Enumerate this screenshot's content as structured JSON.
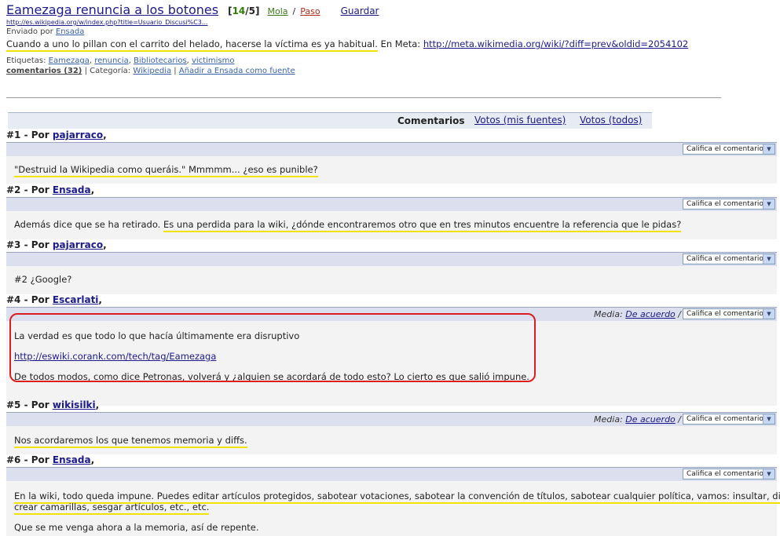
{
  "story": {
    "title": "Eamezaga renuncia a los botones",
    "vote_open": "[",
    "vote_a": "14",
    "vote_sep": "/",
    "vote_b": "5",
    "vote_close": "]",
    "mola": "Mola",
    "slash": "/",
    "paso": "Paso",
    "guardar": "Guardar",
    "url": "http://es.wikipedia.org/w/index.php?title=Usuario_Discusi%C3...",
    "sent_by_label": "Enviado por",
    "sent_by_user": "Ensada",
    "body_text": "Cuando a uno lo pillan con el carrito del helado, hacerse la víctima es ya habitual.",
    "body_meta_label": "En Meta:",
    "body_meta_link": "http://meta.wikimedia.org/wiki/?diff=prev&oldid=2054102",
    "tags_label": "Etiquetas:",
    "tags": [
      "Eamezaga",
      "renuncia",
      "Bibliotecarios",
      "victimismo"
    ],
    "comments_count_label": "comentarios (32)",
    "category_label": "| Categoría:",
    "category": "Wikipedia",
    "add_source": "Añadir a Ensada como fuente"
  },
  "tabs": {
    "comentarios": "Comentarios",
    "votos_fuentes": "Votos (mis fuentes)",
    "votos_todos": "Votos (todos)"
  },
  "select_label": "Califica el comentario",
  "media_label": "Media:",
  "media_value": "De acuerdo",
  "media_sep": "/",
  "comments": [
    {
      "num": "#1 - Por",
      "user": "pajarraco",
      "comma": ",",
      "text": "\"Destruid la Wikipedia como queráis.\" Mmmmm... ¿eso es punible?"
    },
    {
      "num": "#2 - Por",
      "user": "Ensada",
      "comma": ",",
      "text_a": "Además dice que se ha retirado.",
      "text_b": "Es una perdida para la wiki, ¿dónde encontraremos otro que en tres minutos encuentre la referencia que le pidas?"
    },
    {
      "num": "#3 - Por",
      "user": "pajarraco",
      "comma": ",",
      "text": "#2 ¿Google?"
    },
    {
      "num": "#4 - Por",
      "user": "Escarlati",
      "comma": ",",
      "line1": "La verdad es que todo lo que hacía últimamente era disruptivo",
      "link": "http://eswiki.corank.com/tech/tag/Eamezaga",
      "line3": "De todos modos, como dice Petronas, volverá y ¿alguien se acordará de todo esto? Lo cierto es que salió impune."
    },
    {
      "num": "#5 - Por",
      "user": "wikisilki",
      "comma": ",",
      "text": "Nos acordaremos los que tenemos memoria y diffs."
    },
    {
      "num": "#6 - Por",
      "user": "Ensada",
      "comma": ",",
      "line1": "En la wiki, todo queda impune. Puedes editar artículos protegidos, sabotear votaciones, sabotear la convención de títulos, sabotear cualquier política, vamos: insultar, difamar,",
      "line2": "crear camarillas, sesgar artículos, etc., etc.",
      "line3": "Que se me venga ahora a la memoria, así de repente."
    }
  ]
}
